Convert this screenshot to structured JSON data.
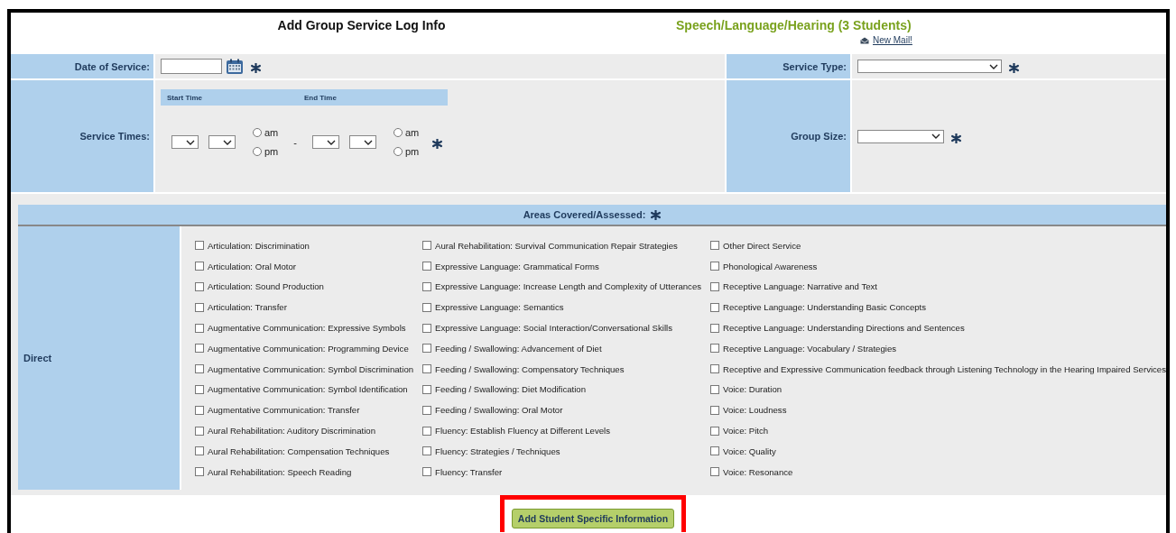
{
  "header": {
    "title": "Add Group Service Log Info",
    "program": "Speech/Language/Hearing (3 Students)",
    "mail_link": "New Mail!"
  },
  "date_of_service": {
    "label": "Date of Service:",
    "required": true
  },
  "service_type": {
    "label": "Service Type:",
    "required": true
  },
  "service_times": {
    "label": "Service Times:",
    "start_label": "Start Time",
    "end_label": "End Time",
    "separator": "-",
    "required": true,
    "start_meridiem": [
      {
        "label": "am",
        "selected": false
      },
      {
        "label": "pm",
        "selected": false
      }
    ],
    "end_meridiem": [
      {
        "label": "am",
        "selected": false
      },
      {
        "label": "pm",
        "selected": false
      }
    ]
  },
  "group_size": {
    "label": "Group Size:",
    "required": true
  },
  "areas": {
    "title": "Areas Covered/Assessed:",
    "required": true,
    "category": "Direct",
    "columns": [
      [
        {
          "label": "Articulation: Discrimination",
          "checked": false
        },
        {
          "label": "Articulation: Oral Motor",
          "checked": false
        },
        {
          "label": "Articulation: Sound Production",
          "checked": false
        },
        {
          "label": "Articulation: Transfer",
          "checked": false
        },
        {
          "label": "Augmentative Communication: Expressive Symbols",
          "checked": false
        },
        {
          "label": "Augmentative Communication: Programming Device",
          "checked": false
        },
        {
          "label": "Augmentative Communication: Symbol Discrimination",
          "checked": false
        },
        {
          "label": "Augmentative Communication: Symbol Identification",
          "checked": false
        },
        {
          "label": "Augmentative Communication: Transfer",
          "checked": false
        },
        {
          "label": "Aural Rehabilitation: Auditory Discrimination",
          "checked": false
        },
        {
          "label": "Aural Rehabilitation: Compensation Techniques",
          "checked": false
        },
        {
          "label": "Aural Rehabilitation: Speech Reading",
          "checked": false
        }
      ],
      [
        {
          "label": "Aural Rehabilitation: Survival Communication Repair Strategies",
          "checked": false
        },
        {
          "label": "Expressive Language: Grammatical Forms",
          "checked": false
        },
        {
          "label": "Expressive Language: Increase Length and Complexity of Utterances",
          "checked": false
        },
        {
          "label": "Expressive Language: Semantics",
          "checked": false
        },
        {
          "label": "Expressive Language: Social Interaction/Conversational Skills",
          "checked": false
        },
        {
          "label": "Feeding / Swallowing: Advancement of Diet",
          "checked": false
        },
        {
          "label": "Feeding / Swallowing: Compensatory Techniques",
          "checked": false
        },
        {
          "label": "Feeding / Swallowing: Diet Modification",
          "checked": false
        },
        {
          "label": "Feeding / Swallowing: Oral Motor",
          "checked": false
        },
        {
          "label": "Fluency: Establish Fluency at Different Levels",
          "checked": false
        },
        {
          "label": "Fluency: Strategies / Techniques",
          "checked": false
        },
        {
          "label": "Fluency: Transfer",
          "checked": false
        }
      ],
      [
        {
          "label": "Other Direct Service",
          "checked": false
        },
        {
          "label": "Phonological Awareness",
          "checked": false
        },
        {
          "label": "Receptive Language: Narrative and Text",
          "checked": false
        },
        {
          "label": "Receptive Language: Understanding Basic Concepts",
          "checked": false
        },
        {
          "label": "Receptive Language: Understanding Directions and Sentences",
          "checked": false
        },
        {
          "label": "Receptive Language: Vocabulary / Strategies",
          "checked": false
        },
        {
          "label": "Receptive and Expressive Communication feedback through Listening Technology in the Hearing Impaired Services",
          "checked": false
        },
        {
          "label": "Voice: Duration",
          "checked": false
        },
        {
          "label": "Voice: Loudness",
          "checked": false
        },
        {
          "label": "Voice: Pitch",
          "checked": false
        },
        {
          "label": "Voice: Quality",
          "checked": false
        },
        {
          "label": "Voice: Resonance",
          "checked": false
        }
      ]
    ]
  },
  "button": {
    "label": "Add Student Specific Information",
    "highlighted": true
  }
}
